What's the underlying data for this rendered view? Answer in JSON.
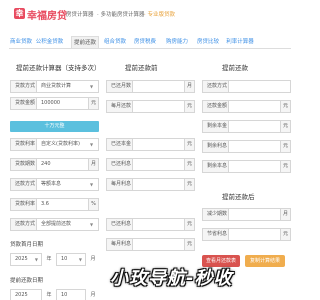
{
  "header": {
    "logo_char": "幸",
    "logo_text": "幸福房贷",
    "links": [
      "房贷计算器",
      "多功能房贷计算器",
      "专业版贷款"
    ]
  },
  "nav": {
    "tabs": [
      "商业贷款",
      "公积金贷款",
      "提前还款",
      "组合贷款",
      "房贷税费",
      "购房能力",
      "房贷比较",
      "利率计算器"
    ],
    "active_index": 2
  },
  "left": {
    "title": "提前还款计算器（支持多次）",
    "loan_type": {
      "label": "还款方式",
      "value": "贷款类型"
    },
    "rows1": [
      {
        "label": "贷款方式",
        "value": "商业贷款计算",
        "unit": ""
      },
      {
        "label": "贷款金额",
        "value": "100000",
        "unit": "元"
      }
    ],
    "calc_button": "十万元整",
    "rows2": [
      {
        "label": "贷款利率",
        "value": "自定义(贷款利率)",
        "unit": ""
      },
      {
        "label": "贷款期数",
        "value": "240",
        "unit": "月"
      },
      {
        "label": "还款方式",
        "value": "等额本息",
        "unit": ""
      },
      {
        "label": "贷款利率",
        "value": "3.6",
        "unit": "%"
      },
      {
        "label": "还款方式",
        "value": "全部提前还款",
        "unit": ""
      }
    ],
    "first_date": {
      "label": "贷款首月日期",
      "year": "2025",
      "year_unit": "年",
      "month": "10",
      "month_unit": "月"
    },
    "second_date": {
      "label": "提前还款日期",
      "year": "2025",
      "year_unit": "年",
      "month": "10",
      "month_unit": "月"
    }
  },
  "middle": {
    "title": "提前还款前",
    "rows": [
      {
        "label": "已还月数",
        "value": "",
        "unit": "月"
      },
      {
        "label": "每月还款",
        "value": "",
        "unit": "元"
      },
      {
        "label": "已还本金",
        "value": "",
        "unit": "元"
      },
      {
        "label": "已还利息",
        "value": "",
        "unit": "元"
      },
      {
        "label": "每月利息",
        "value": "",
        "unit": "元"
      },
      {
        "label": "已还利息",
        "value": "",
        "unit": "元"
      },
      {
        "label": "每月利息",
        "value": "",
        "unit": "元"
      }
    ]
  },
  "right": {
    "title1": "提前还款",
    "rows1": [
      {
        "label": "还款方式",
        "value": "",
        "unit": ""
      },
      {
        "label": "还款金额",
        "value": "",
        "unit": "元"
      },
      {
        "label": "剩余本金",
        "value": "",
        "unit": "元"
      },
      {
        "label": "剩余利息",
        "value": "",
        "unit": "元"
      },
      {
        "label": "剩余本息",
        "value": "",
        "unit": "元"
      }
    ],
    "title2": "提前还款后",
    "rows2": [
      {
        "label": "减少期数",
        "value": "",
        "unit": "月"
      },
      {
        "label": "节省利息",
        "value": "",
        "unit": "元"
      }
    ],
    "btn_calc": "查看月还款表",
    "btn_reset": "复制计算结果"
  },
  "watermark": "小玫导航-秒收"
}
